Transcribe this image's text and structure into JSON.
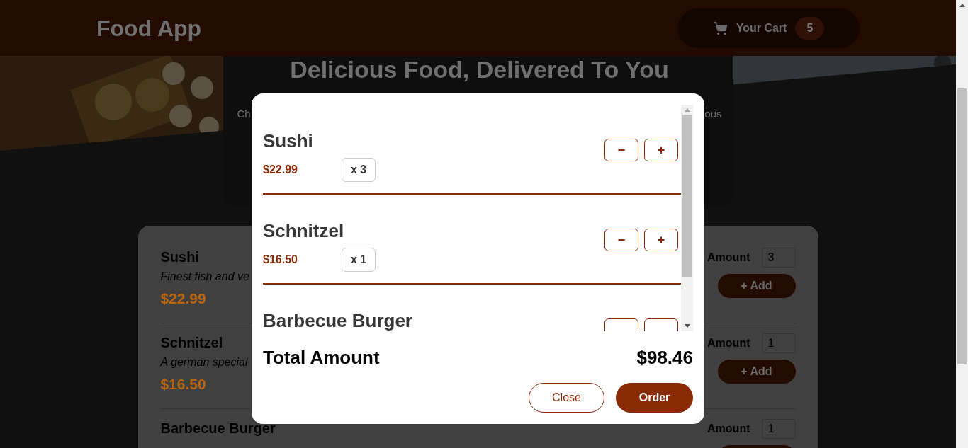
{
  "header": {
    "title": "Food App",
    "cart": {
      "label": "Your Cart",
      "count": "5"
    }
  },
  "summary": {
    "title": "Delicious Food, Delivered To You",
    "text_left": "Ch",
    "text_right": "ous"
  },
  "meals": [
    {
      "name": "Sushi",
      "description": "Finest fish and ve",
      "price": "$22.99",
      "amount_label": "Amount",
      "amount": "3",
      "add_label": "+ Add"
    },
    {
      "name": "Schnitzel",
      "description": "A german special",
      "price": "$16.50",
      "amount_label": "Amount",
      "amount": "1",
      "add_label": "+ Add"
    },
    {
      "name": "Barbecue Burger",
      "amount_label": "Amount",
      "amount": "1"
    }
  ],
  "cart_modal": {
    "items": [
      {
        "name": "Sushi",
        "kind": "full",
        "price": "$22.99",
        "quantity": "x 3",
        "buttons": [
          {
            "label": "−"
          },
          {
            "label": "+"
          }
        ]
      },
      {
        "name": "Schnitzel",
        "kind": "full",
        "price": "$16.50",
        "quantity": "x 1",
        "buttons": [
          {
            "label": "−"
          },
          {
            "label": "+"
          }
        ]
      },
      {
        "name": "Barbecue Burger",
        "kind": "cut"
      }
    ],
    "total_label": "Total Amount",
    "total": "$98.46",
    "close": "Close",
    "order": "Order"
  }
}
